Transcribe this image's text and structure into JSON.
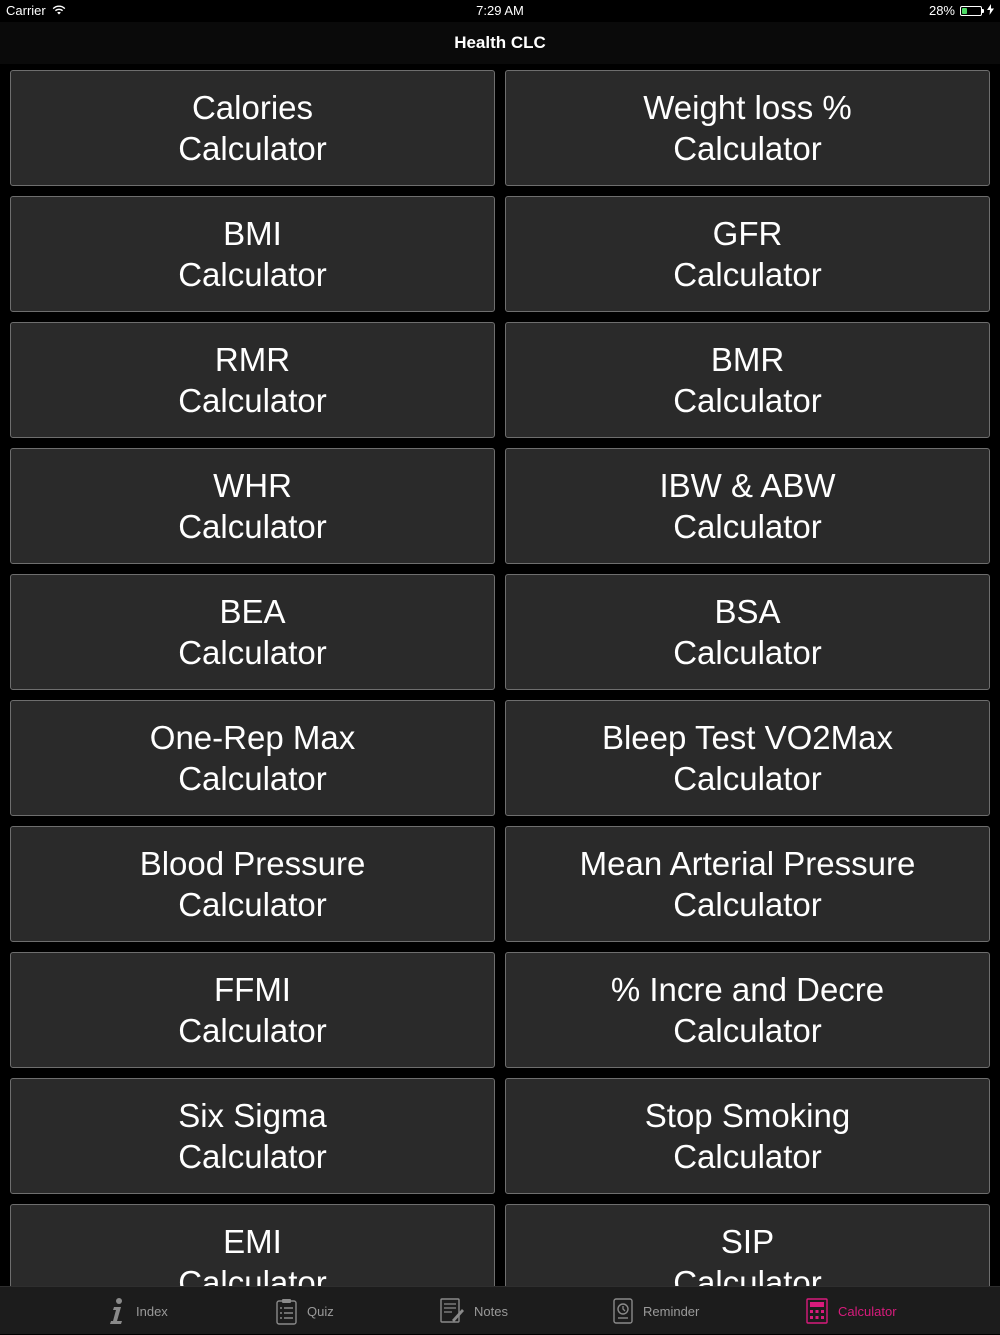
{
  "status_bar": {
    "carrier": "Carrier",
    "time": "7:29 AM",
    "battery_percent": "28%",
    "battery_level": 0.28
  },
  "nav": {
    "title": "Health CLC"
  },
  "calculators": [
    {
      "title": "Calories",
      "subtitle": "Calculator"
    },
    {
      "title": "Weight loss %",
      "subtitle": "Calculator"
    },
    {
      "title": "BMI",
      "subtitle": "Calculator"
    },
    {
      "title": "GFR",
      "subtitle": "Calculator"
    },
    {
      "title": "RMR",
      "subtitle": "Calculator"
    },
    {
      "title": "BMR",
      "subtitle": "Calculator"
    },
    {
      "title": "WHR",
      "subtitle": "Calculator"
    },
    {
      "title": "IBW & ABW",
      "subtitle": "Calculator"
    },
    {
      "title": "BEA",
      "subtitle": "Calculator"
    },
    {
      "title": "BSA",
      "subtitle": "Calculator"
    },
    {
      "title": "One-Rep Max",
      "subtitle": "Calculator"
    },
    {
      "title": "Bleep Test VO2Max",
      "subtitle": "Calculator"
    },
    {
      "title": "Blood Pressure",
      "subtitle": "Calculator"
    },
    {
      "title": "Mean Arterial Pressure",
      "subtitle": "Calculator"
    },
    {
      "title": "FFMI",
      "subtitle": "Calculator"
    },
    {
      "title": "% Incre and Decre",
      "subtitle": "Calculator"
    },
    {
      "title": "Six Sigma",
      "subtitle": "Calculator"
    },
    {
      "title": "Stop Smoking",
      "subtitle": "Calculator"
    },
    {
      "title": "EMI",
      "subtitle": "Calculator"
    },
    {
      "title": "SIP",
      "subtitle": "Calculator"
    }
  ],
  "tab_bar": {
    "tabs": [
      {
        "label": "Index",
        "icon": "info-icon"
      },
      {
        "label": "Quiz",
        "icon": "quiz-icon"
      },
      {
        "label": "Notes",
        "icon": "notes-icon"
      },
      {
        "label": "Reminder",
        "icon": "reminder-icon"
      },
      {
        "label": "Calculator",
        "icon": "calculator-icon"
      }
    ],
    "active_tab": "Calculator",
    "active_color": "#d81b7c",
    "inactive_color": "#9a9a9a"
  }
}
